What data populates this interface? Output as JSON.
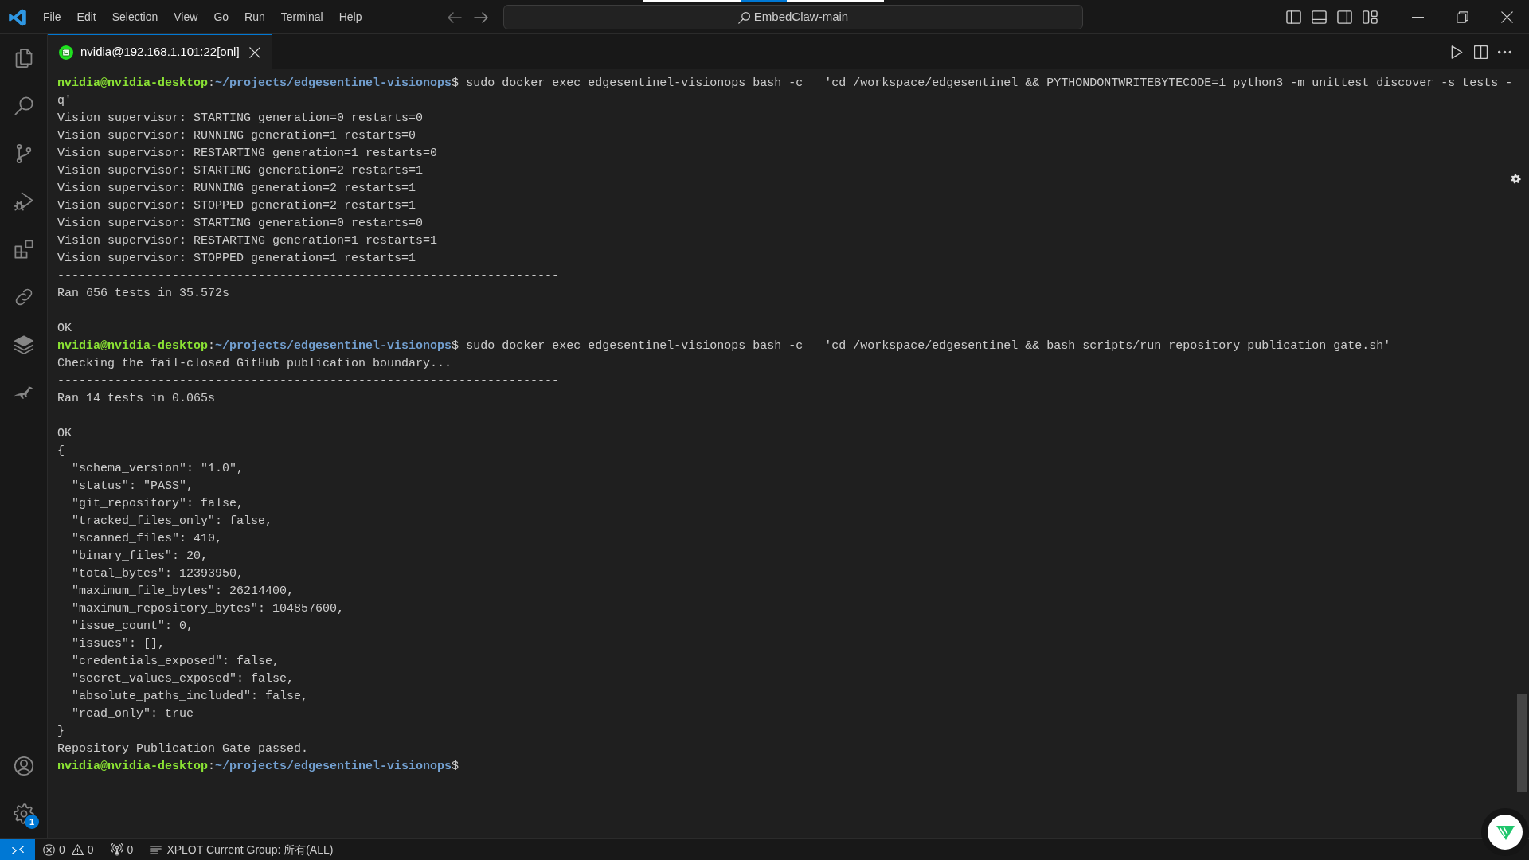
{
  "window": {
    "title": "EmbedClaw-main"
  },
  "menu": [
    "File",
    "Edit",
    "Selection",
    "View",
    "Go",
    "Run",
    "Terminal",
    "Help"
  ],
  "activity_bar": {
    "items": [
      {
        "kind": "files"
      },
      {
        "kind": "search"
      },
      {
        "kind": "branch"
      },
      {
        "kind": "debug"
      },
      {
        "kind": "extensions"
      },
      {
        "kind": "link"
      },
      {
        "kind": "layers"
      },
      {
        "kind": "kangaroo"
      }
    ],
    "bottom": [
      {
        "kind": "account"
      },
      {
        "kind": "settings",
        "badge": "1"
      }
    ]
  },
  "tabs": [
    {
      "label": "nvidia@192.168.1.101:22[onl]",
      "selected": true
    }
  ],
  "terminal": {
    "lines": [
      {
        "kind": "prompt",
        "segments": [
          {
            "kind": "user",
            "text": "nvidia@nvidia-desktop"
          },
          {
            "kind": "plain",
            "text": ":"
          },
          {
            "kind": "path",
            "text": "~/projects/edgesentinel-visionops"
          },
          {
            "kind": "plain",
            "text": "$"
          }
        ],
        "command": "sudo docker exec edgesentinel-visionops bash -c   'cd /workspace/edgesentinel && PYTHONDONTWRITEBYTECODE=1 python3 -m unittest discover -s tests -"
      },
      {
        "kind": "output",
        "text": "q'"
      },
      {
        "kind": "output",
        "text": "Vision supervisor: STARTING generation=0 restarts=0"
      },
      {
        "kind": "output",
        "text": "Vision supervisor: RUNNING generation=1 restarts=0"
      },
      {
        "kind": "output",
        "text": "Vision supervisor: RESTARTING generation=1 restarts=0"
      },
      {
        "kind": "output",
        "text": "Vision supervisor: STARTING generation=2 restarts=1"
      },
      {
        "kind": "output",
        "text": "Vision supervisor: RUNNING generation=2 restarts=1"
      },
      {
        "kind": "output",
        "text": "Vision supervisor: STOPPED generation=2 restarts=1"
      },
      {
        "kind": "output",
        "text": "Vision supervisor: STARTING generation=0 restarts=0"
      },
      {
        "kind": "output",
        "text": "Vision supervisor: RESTARTING generation=1 restarts=1"
      },
      {
        "kind": "output",
        "text": "Vision supervisor: STOPPED generation=1 restarts=1"
      },
      {
        "kind": "output",
        "text": "----------------------------------------------------------------------"
      },
      {
        "kind": "output",
        "text": "Ran 656 tests in 35.572s"
      },
      {
        "kind": "blank"
      },
      {
        "kind": "output",
        "text": "OK"
      },
      {
        "kind": "prompt",
        "segments": [
          {
            "kind": "user",
            "text": "nvidia@nvidia-desktop"
          },
          {
            "kind": "plain",
            "text": ":"
          },
          {
            "kind": "path",
            "text": "~/projects/edgesentinel-visionops"
          },
          {
            "kind": "plain",
            "text": "$"
          }
        ],
        "command": "sudo docker exec edgesentinel-visionops bash -c   'cd /workspace/edgesentinel && bash scripts/run_repository_publication_gate.sh'"
      },
      {
        "kind": "output",
        "text": "Checking the fail-closed GitHub publication boundary..."
      },
      {
        "kind": "output",
        "text": "----------------------------------------------------------------------"
      },
      {
        "kind": "output",
        "text": "Ran 14 tests in 0.065s"
      },
      {
        "kind": "blank"
      },
      {
        "kind": "output",
        "text": "OK"
      },
      {
        "kind": "output",
        "text": "{",
        "children": [
          {
            "kind": "output",
            "text": "\"schema_version\": \"1.0\","
          },
          {
            "kind": "output",
            "text": "\"status\": \"PASS\","
          },
          {
            "kind": "output",
            "text": "\"git_repository\": false,"
          },
          {
            "kind": "output",
            "text": "\"tracked_files_only\": false,"
          },
          {
            "kind": "output",
            "text": "\"scanned_files\": 410,"
          },
          {
            "kind": "output",
            "text": "\"binary_files\": 20,"
          },
          {
            "kind": "output",
            "text": "\"total_bytes\": 12393950,"
          },
          {
            "kind": "output",
            "text": "\"maximum_file_bytes\": 26214400,"
          },
          {
            "kind": "output",
            "text": "\"maximum_repository_bytes\": 104857600,"
          },
          {
            "kind": "output",
            "text": "\"issue_count\": 0,"
          },
          {
            "kind": "output",
            "text": "\"issues\": [],"
          },
          {
            "kind": "output",
            "text": "\"credentials_exposed\": false,"
          },
          {
            "kind": "output",
            "text": "\"secret_values_exposed\": false,"
          },
          {
            "kind": "output",
            "text": "\"absolute_paths_included\": false,"
          },
          {
            "kind": "output",
            "text": "\"read_only\": true"
          }
        ]
      },
      {
        "kind": "output",
        "text": "}"
      },
      {
        "kind": "output",
        "text": "Repository Publication Gate passed."
      },
      {
        "kind": "prompt",
        "segments": [
          {
            "kind": "user",
            "text": "nvidia@nvidia-desktop"
          },
          {
            "kind": "plain",
            "text": ":"
          },
          {
            "kind": "path",
            "text": "~/projects/edgesentinel-visionops"
          },
          {
            "kind": "plain",
            "text": "$"
          }
        ]
      }
    ]
  },
  "status_bar": {
    "errors": "0",
    "warnings": "0",
    "ports": "0",
    "group": "XPLOT Current Group: 所有(ALL)"
  }
}
